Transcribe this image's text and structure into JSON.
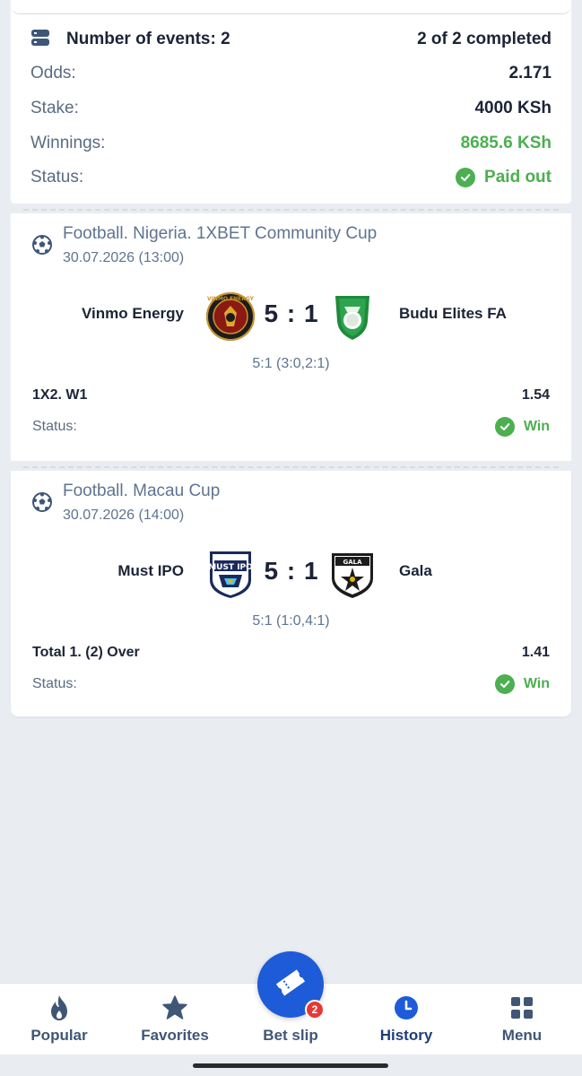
{
  "summary": {
    "events_label": "Number of events: 2",
    "completed": "2 of 2 completed",
    "odds_label": "Odds:",
    "odds_value": "2.171",
    "stake_label": "Stake:",
    "stake_value": "4000 KSh",
    "winnings_label": "Winnings:",
    "winnings_value": "8685.6 KSh",
    "status_label": "Status:",
    "status_value": "Paid out"
  },
  "events": [
    {
      "league": "Football. Nigeria. 1XBET Community Cup",
      "date": "30.07.2026 (13:00)",
      "team_home": "Vinmo Energy",
      "team_away": "Budu Elites FA",
      "score": "5 : 1",
      "score_detail": "5:1 (3:0,2:1)",
      "market": "1X2. W1",
      "coef": "1.54",
      "status_label": "Status:",
      "status_value": "Win"
    },
    {
      "league": "Football. Macau Cup",
      "date": "30.07.2026 (14:00)",
      "team_home": "Must IPO",
      "team_away": "Gala",
      "score": "5 : 1",
      "score_detail": "5:1 (1:0,4:1)",
      "market": "Total 1. (2) Over",
      "coef": "1.41",
      "status_label": "Status:",
      "status_value": "Win"
    }
  ],
  "logos": {
    "vinmo": "VINMO ENERGY",
    "must": "MUST IPO",
    "gala": "GALA"
  },
  "tabbar": {
    "popular": "Popular",
    "favorites": "Favorites",
    "betslip": "Bet slip",
    "betslip_badge": "2",
    "history": "History",
    "menu": "Menu"
  },
  "colors": {
    "accent": "#1d5bd8",
    "win_green": "#4caf50",
    "text_dark": "#1b2436",
    "text_muted": "#5f7490",
    "background": "#e9edf2"
  }
}
